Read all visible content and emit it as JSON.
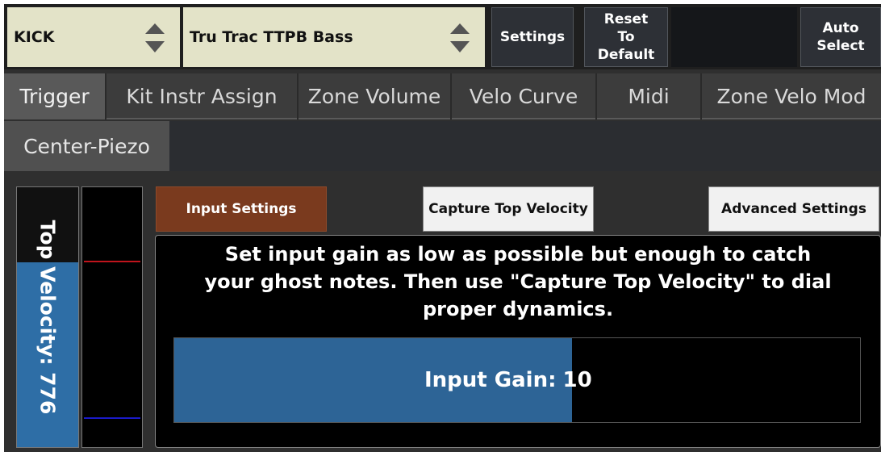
{
  "header": {
    "instrument_select": "KICK",
    "preset_select": "Tru Trac TTPB Bass",
    "settings_label": "Settings",
    "reset_label_lines": [
      "Reset",
      "To",
      "Default"
    ],
    "auto_select_lines": [
      "Auto",
      "Select"
    ]
  },
  "tabs": [
    {
      "label": "Trigger",
      "active": true
    },
    {
      "label": "Kit Instr Assign",
      "active": false
    },
    {
      "label": "Zone Volume",
      "active": false
    },
    {
      "label": "Velo Curve",
      "active": false
    },
    {
      "label": "Midi",
      "active": false
    },
    {
      "label": "Zone Velo Mod",
      "active": false
    }
  ],
  "subtabs": {
    "zone": "Center-Piezo"
  },
  "meter": {
    "label": "Top Velocity: 776",
    "level_fraction": 0.71,
    "fill_color": "#2e6ea6"
  },
  "scope": {
    "lines": [
      {
        "color": "#c0141c",
        "level_fraction": 0.71
      },
      {
        "color": "#1a1ac8",
        "level_fraction": 0.11
      }
    ]
  },
  "modes": {
    "input_settings": "Input Settings",
    "capture_top_velocity": "Capture Top Velocity",
    "advanced_settings": "Advanced Settings"
  },
  "panel": {
    "instructions": "Set input gain as low as possible but enough to catch your ghost notes. Then use \"Capture Top Velocity\" to dial proper dynamics.",
    "gain_label": "Input Gain:",
    "gain_value": "10",
    "gain_fraction": 0.58
  },
  "colors": {
    "select_bg": "#e3e3c8",
    "active_mode": "#7a3a1e",
    "gain_fill": "#2d6496"
  }
}
